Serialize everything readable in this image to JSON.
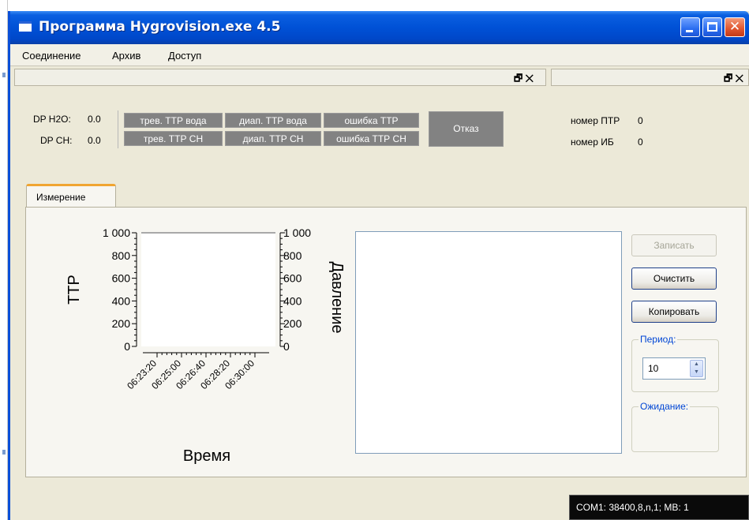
{
  "window": {
    "title": "Программа Hygrovision.exe 4.5",
    "controls": {
      "minimize": "minimize",
      "maximize": "maximize",
      "close": "✕"
    }
  },
  "menu": {
    "items": [
      {
        "label": "Соединение"
      },
      {
        "label": "Архив"
      },
      {
        "label": "Доступ"
      }
    ]
  },
  "docks": {
    "left_controls": "🗗 ✕",
    "right_controls": "🗗 ✕"
  },
  "readings": {
    "dp_h2o_label": "DP H2O:",
    "dp_h2o_value": "0.0",
    "dp_ch_label": "DP CH:",
    "dp_ch_value": "0.0"
  },
  "indicators": {
    "row1": [
      "трев. ТТР вода",
      "диап. ТТР вода",
      "ошибка ТТР"
    ],
    "row2": [
      "трев. ТТР СН",
      "диап. ТТР СН",
      "ошибка ТТР СН"
    ],
    "fault": "Отказ",
    "color": "#828282"
  },
  "device": {
    "ptr_label": "номер ПТР",
    "ptr_value": "0",
    "ib_label": "номер ИБ",
    "ib_value": "0"
  },
  "tabs": [
    {
      "label": "Измерение",
      "active": true
    }
  ],
  "chart_data": {
    "type": "line",
    "title": "",
    "xlabel": "Время",
    "ylabel": "ТТР",
    "y2label": "Давление",
    "x_ticks": [
      "06:23:20",
      "06:25:00",
      "06:26:40",
      "06:28:20",
      "06:30:00"
    ],
    "y_ticks": [
      "1 000",
      "800",
      "600",
      "400",
      "200",
      "0"
    ],
    "y2_ticks": [
      "1 000",
      "800",
      "600",
      "400",
      "200",
      "0"
    ],
    "ylim": [
      0,
      1000
    ],
    "y2lim": [
      0,
      1000
    ],
    "series": [],
    "grid": false
  },
  "log": {
    "text": ""
  },
  "buttons": {
    "write": "Записать",
    "clear": "Очистить",
    "copy": "Копировать"
  },
  "period": {
    "group_label": "Период:",
    "value": "10"
  },
  "waiting": {
    "group_label": "Ожидание:"
  },
  "status_bar": {
    "text": "COM1: 38400,8,n,1; MB: 1"
  }
}
